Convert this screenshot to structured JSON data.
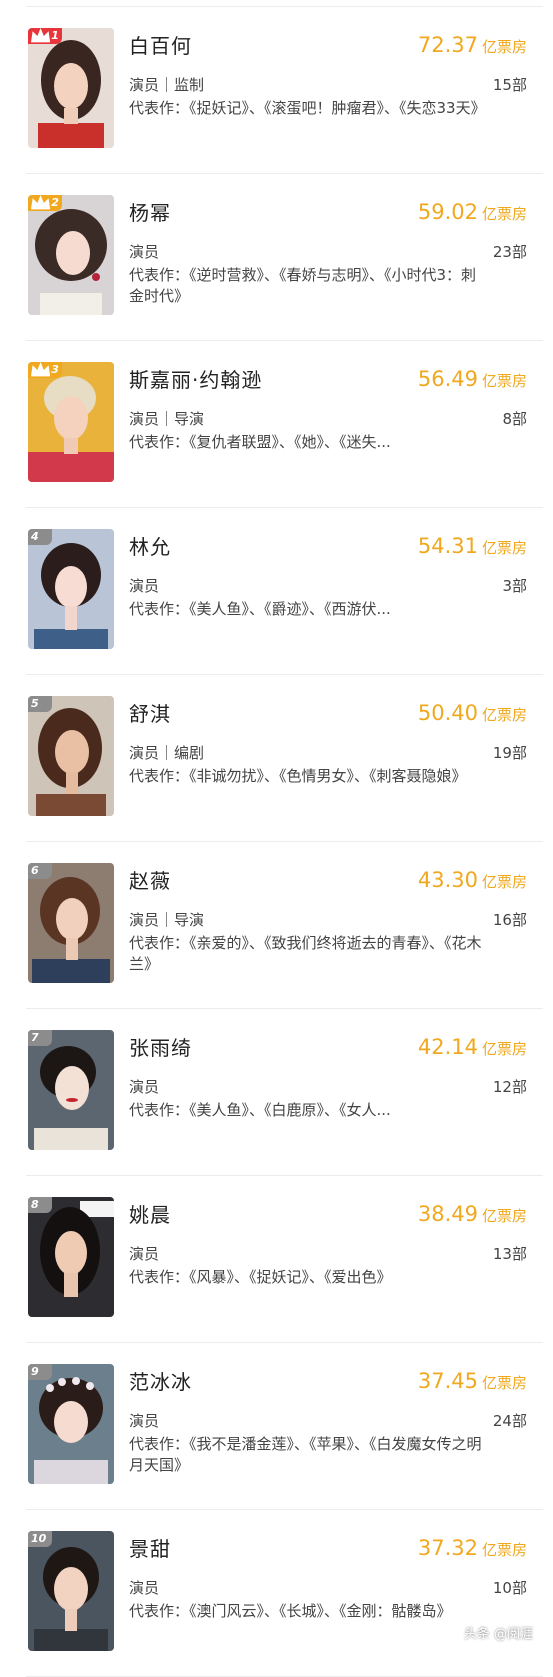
{
  "colors": {
    "accent_box_office": "#f0a81e",
    "rank_top": "#e8353b",
    "rank_gold": "#f0a81e",
    "rank_other": "#8c8c8c"
  },
  "box_unit": "亿票房",
  "films_suffix": "部",
  "watermark": "头条 @阅涯",
  "stars": [
    {
      "rank": "1",
      "name": "白百何",
      "box_office": "72.37",
      "role": "演员｜监制",
      "films": "15",
      "works": "代表作：《捉妖记》、《滚蛋吧！肿瘤君》、《失恋33天》",
      "badge_icon": "crown-icon"
    },
    {
      "rank": "2",
      "name": "杨幂",
      "box_office": "59.02",
      "role": "演员",
      "films": "23",
      "works": "代表作：《逆时营救》、《春娇与志明》、《小时代3：刺金时代》",
      "badge_icon": "crown-icon"
    },
    {
      "rank": "3",
      "name": "斯嘉丽·约翰逊",
      "box_office": "56.49",
      "role": "演员｜导演",
      "films": "8",
      "works": "代表作：《复仇者联盟》、《她》、《迷失...",
      "badge_icon": "crown-icon"
    },
    {
      "rank": "4",
      "name": "林允",
      "box_office": "54.31",
      "role": "演员",
      "films": "3",
      "works": "代表作：《美人鱼》、《爵迹》、《西游伏...",
      "badge_icon": ""
    },
    {
      "rank": "5",
      "name": "舒淇",
      "box_office": "50.40",
      "role": "演员｜编剧",
      "films": "19",
      "works": "代表作：《非诚勿扰》、《色情男女》、《刺客聂隐娘》",
      "badge_icon": ""
    },
    {
      "rank": "6",
      "name": "赵薇",
      "box_office": "43.30",
      "role": "演员｜导演",
      "films": "16",
      "works": "代表作：《亲爱的》、《致我们终将逝去的青春》、《花木兰》",
      "badge_icon": ""
    },
    {
      "rank": "7",
      "name": "张雨绮",
      "box_office": "42.14",
      "role": "演员",
      "films": "12",
      "works": "代表作：《美人鱼》、《白鹿原》、《女人...",
      "badge_icon": ""
    },
    {
      "rank": "8",
      "name": "姚晨",
      "box_office": "38.49",
      "role": "演员",
      "films": "13",
      "works": "代表作：《风暴》、《捉妖记》、《爱出色》",
      "badge_icon": ""
    },
    {
      "rank": "9",
      "name": "范冰冰",
      "box_office": "37.45",
      "role": "演员",
      "films": "24",
      "works": "代表作：《我不是潘金莲》、《苹果》、《白发魔女传之明月天国》",
      "badge_icon": ""
    },
    {
      "rank": "10",
      "name": "景甜",
      "box_office": "37.32",
      "role": "演员",
      "films": "10",
      "works": "代表作：《澳门风云》、《长城》、《金刚：骷髅岛》",
      "badge_icon": ""
    }
  ]
}
